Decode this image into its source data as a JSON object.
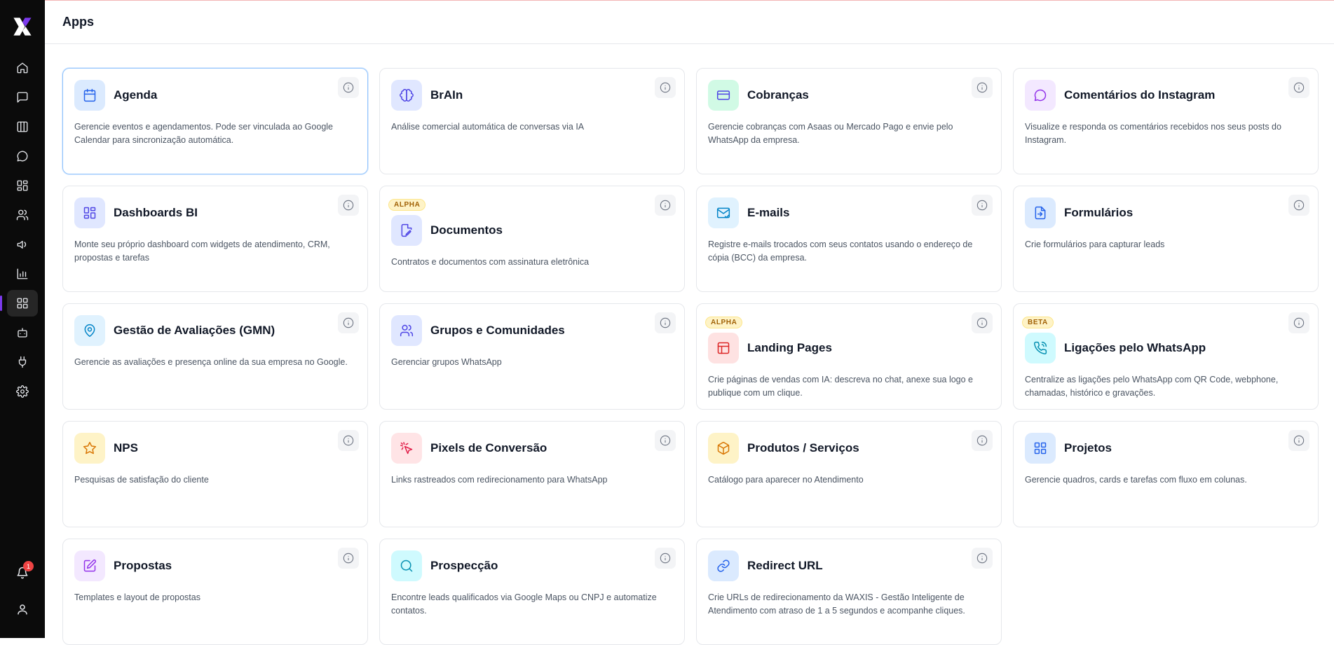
{
  "header": {
    "title": "Apps"
  },
  "sidebar": {
    "logo": "waxis-logo",
    "items": [
      {
        "icon": "home-icon"
      },
      {
        "icon": "message-square-icon"
      },
      {
        "icon": "columns-icon"
      },
      {
        "icon": "chat-bubble-icon"
      },
      {
        "icon": "dashboard-icon"
      },
      {
        "icon": "users-icon"
      },
      {
        "icon": "megaphone-icon"
      },
      {
        "icon": "bar-chart-icon"
      },
      {
        "icon": "apps-grid-icon",
        "active": true
      },
      {
        "icon": "bot-icon"
      },
      {
        "icon": "plug-icon"
      },
      {
        "icon": "gear-icon"
      }
    ],
    "notifications_count": "1"
  },
  "colors": {
    "accent": "#7c3aed",
    "sidebar_bg": "#0b0b0b",
    "selected_border": "#93c5fd",
    "tag_bg": "#fef3c7",
    "tag_text": "#a16207"
  },
  "apps": [
    {
      "title": "Agenda",
      "desc": "Gerencie eventos e agendamentos. Pode ser vinculada ao Google Calendar para sincronização automática.",
      "icon": "calendar-icon",
      "icon_bg": "#dbeafe",
      "icon_color": "#2563eb"
    },
    {
      "title": "BrAIn",
      "desc": "Análise comercial automática de conversas via IA",
      "icon": "brain-icon",
      "icon_bg": "#e0e7ff",
      "icon_color": "#4f46e5"
    },
    {
      "title": "Cobranças",
      "desc": "Gerencie cobranças com Asaas ou Mercado Pago e envie pelo WhatsApp da empresa.",
      "icon": "credit-card-icon",
      "icon_bg": "#d1fae5",
      "icon_color": "#4f46e5"
    },
    {
      "title": "Comentários do Instagram",
      "desc": "Visualize e responda os comentários recebidos nos seus posts do Instagram.",
      "icon": "comment-icon",
      "icon_bg": "#f3e8ff",
      "icon_color": "#9333ea"
    },
    {
      "title": "Dashboards BI",
      "desc": "Monte seu próprio dashboard com widgets de atendimento, CRM, propostas e tarefas",
      "icon": "dashboard-icon",
      "icon_bg": "#e0e7ff",
      "icon_color": "#4f46e5"
    },
    {
      "title": "Documentos",
      "desc": "Contratos e documentos com assinatura eletrônica",
      "icon": "document-edit-icon",
      "icon_bg": "#e0e7ff",
      "icon_color": "#4f46e5",
      "tag": "ALPHA"
    },
    {
      "title": "E-mails",
      "desc": "Registre e-mails trocados com seus contatos usando o endereço de cópia (BCC) da empresa.",
      "icon": "mail-check-icon",
      "icon_bg": "#e0f2fe",
      "icon_color": "#0284c7"
    },
    {
      "title": "Formulários",
      "desc": "Crie formulários para capturar leads",
      "icon": "form-enter-icon",
      "icon_bg": "#dbeafe",
      "icon_color": "#2563eb"
    },
    {
      "title": "Gestão de Avaliações (GMN)",
      "desc": "Gerencie as avaliações e presença online da sua empresa no Google.",
      "icon": "map-pin-icon",
      "icon_bg": "#e0f2fe",
      "icon_color": "#0284c7"
    },
    {
      "title": "Grupos e Comunidades",
      "desc": "Gerenciar grupos WhatsApp",
      "icon": "users-icon",
      "icon_bg": "#e0e7ff",
      "icon_color": "#4f46e5"
    },
    {
      "title": "Landing Pages",
      "desc": "Crie páginas de vendas com IA: descreva no chat, anexe sua logo e publique com um clique.",
      "icon": "layout-icon",
      "icon_bg": "#fee2e2",
      "icon_color": "#dc2626",
      "tag": "ALPHA"
    },
    {
      "title": "Ligações pelo WhatsApp",
      "desc": "Centralize as ligações pelo WhatsApp com QR Code, webphone, chamadas, histórico e gravações.",
      "icon": "phone-call-icon",
      "icon_bg": "#cffafe",
      "icon_color": "#0891b2",
      "tag": "BETA"
    },
    {
      "title": "NPS",
      "desc": "Pesquisas de satisfação do cliente",
      "icon": "star-icon",
      "icon_bg": "#fef3c7",
      "icon_color": "#d97706"
    },
    {
      "title": "Pixels de Conversão",
      "desc": "Links rastreados com redirecionamento para WhatsApp",
      "icon": "cursor-click-icon",
      "icon_bg": "#ffe4e6",
      "icon_color": "#e11d48"
    },
    {
      "title": "Produtos / Serviços",
      "desc": "Catálogo para aparecer no Atendimento",
      "icon": "package-icon",
      "icon_bg": "#fef3c7",
      "icon_color": "#d97706"
    },
    {
      "title": "Projetos",
      "desc": "Gerencie quadros, cards e tarefas com fluxo em colunas.",
      "icon": "grid-icon",
      "icon_bg": "#dbeafe",
      "icon_color": "#2563eb"
    },
    {
      "title": "Propostas",
      "desc": "Templates e layout de propostas",
      "icon": "file-edit-icon",
      "icon_bg": "#f3e8ff",
      "icon_color": "#9333ea"
    },
    {
      "title": "Prospecção",
      "desc": "Encontre leads qualificados via Google Maps ou CNPJ e automatize contatos.",
      "icon": "search-icon",
      "icon_bg": "#cffafe",
      "icon_color": "#0891b2"
    },
    {
      "title": "Redirect URL",
      "desc": "Crie URLs de redirecionamento da WAXIS - Gestão Inteligente de Atendimento com atraso de 1 a 5 segundos e acompanhe cliques.",
      "icon": "link-icon",
      "icon_bg": "#dbeafe",
      "icon_color": "#2563eb"
    }
  ]
}
